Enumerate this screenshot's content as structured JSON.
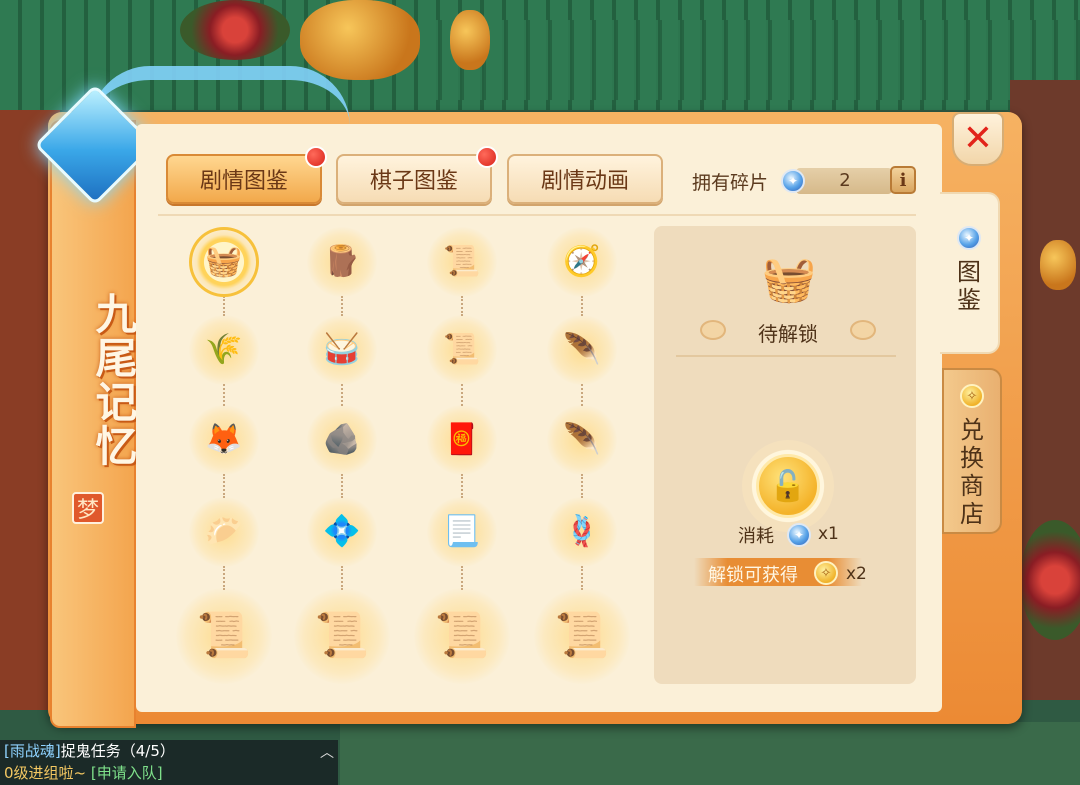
{
  "chat": {
    "line1_channel": "[雨战魂]",
    "line1_text": "捉鬼任务（4/5）",
    "line2_text": "0级进组啦~",
    "line2_join": "[申请入队]"
  },
  "banner": {
    "title": "九尾记忆",
    "seal": "梦"
  },
  "tabs": [
    {
      "label": "剧情图鉴",
      "active": true,
      "has_dot": true
    },
    {
      "label": "棋子图鉴",
      "active": false,
      "has_dot": true
    },
    {
      "label": "剧情动画",
      "active": false,
      "has_dot": false
    }
  ],
  "fragments": {
    "label": "拥有碎片",
    "count": "2",
    "info": "i"
  },
  "grid": {
    "rows": [
      [
        {
          "icon": "basket-icon",
          "glyph": "🧺",
          "selected": true
        },
        {
          "icon": "scroll-bundle-icon",
          "glyph": "🪵"
        },
        {
          "icon": "chess-board-icon",
          "glyph": "📜"
        },
        {
          "icon": "compass-icon",
          "glyph": "🧭"
        }
      ],
      [
        {
          "icon": "wheat-icon",
          "glyph": "🌾"
        },
        {
          "icon": "drum-icon",
          "glyph": "🥁"
        },
        {
          "icon": "chess-board-icon",
          "glyph": "📜"
        },
        {
          "icon": "fan-icon",
          "glyph": "🪶"
        }
      ],
      [
        {
          "icon": "fox-mask-icon",
          "glyph": "🦊"
        },
        {
          "icon": "stone-tablet-icon",
          "glyph": "🪨"
        },
        {
          "icon": "talisman-icon",
          "glyph": "🧧"
        },
        {
          "icon": "fan-icon",
          "glyph": "🪶"
        }
      ],
      [
        {
          "icon": "bun-icon",
          "glyph": "🥟"
        },
        {
          "icon": "crystal-shards-icon",
          "glyph": "💠"
        },
        {
          "icon": "paper-scroll-icon",
          "glyph": "📃"
        },
        {
          "icon": "rope-icon",
          "glyph": "🪢"
        }
      ],
      [
        {
          "icon": "story-scroll-icon",
          "glyph": "📜",
          "scroll": true
        },
        {
          "icon": "story-scroll-icon",
          "glyph": "📜",
          "scroll": true
        },
        {
          "icon": "story-scroll-icon",
          "glyph": "📜",
          "scroll": true
        },
        {
          "icon": "story-scroll-icon",
          "glyph": "📜",
          "scroll": true
        }
      ]
    ]
  },
  "detail": {
    "item_icon": "basket-icon",
    "item_glyph": "🧺",
    "status": "待解锁",
    "lock_glyph": "🔓",
    "cost_label": "消耗",
    "cost_mult": "x1",
    "reward_label": "解锁可获得",
    "reward_mult": "x2"
  },
  "side_tabs": [
    {
      "label": "图鉴",
      "active": true,
      "icon": "crystal-icon"
    },
    {
      "label": "兑换商店",
      "active": false,
      "icon": "coin-icon"
    }
  ],
  "colors": {
    "accent": "#f2a94b",
    "panel": "#fbf0d8",
    "close": "#e2231a"
  }
}
